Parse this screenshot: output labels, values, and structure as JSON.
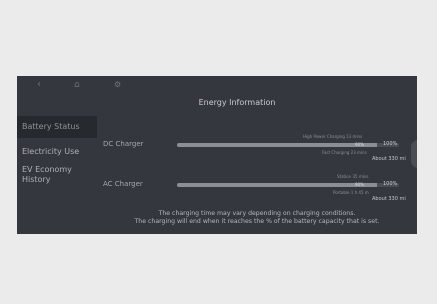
{
  "screen": {
    "title": "Energy Information",
    "icons": [
      "back-arrow-icon",
      "home-icon",
      "settings-icon"
    ]
  },
  "sidebar": {
    "items": [
      {
        "label": "Battery Status",
        "active": true
      },
      {
        "label": "Electricity Use",
        "active": false
      },
      {
        "label": "EV Economy History",
        "active": false
      }
    ]
  },
  "chargers": [
    {
      "label": "DC Charger",
      "top_caption": "High Power Charging 13 mins",
      "mid_caption": "Fast Charging 23 mins",
      "bar_text": "90%",
      "percent": "100%",
      "about": "About 330 mi",
      "fill_fraction": 0.9
    },
    {
      "label": "AC Charger",
      "top_caption": "Station 35 mins",
      "mid_caption": "Portable 1 h 45 m",
      "bar_text": "90%",
      "percent": "100%",
      "about": "About 330 mi",
      "fill_fraction": 0.9
    }
  ],
  "note": {
    "line1": "The charging time may vary depending on charging conditions.",
    "line2": "The charging will end when it reaches the % of the battery capacity that is set."
  }
}
